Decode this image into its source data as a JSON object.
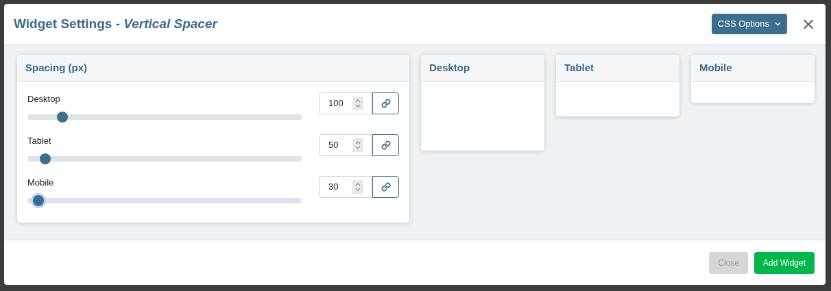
{
  "dialog": {
    "title": "Widget Settings - ",
    "subtitle": "Vertical Spacer",
    "css_button": "CSS Options",
    "close_icon": "×"
  },
  "spacing": {
    "title": "Spacing (px)",
    "rows": [
      {
        "label": "Desktop",
        "level": 0.11,
        "focused": false,
        "value": "100"
      },
      {
        "label": "Tablet",
        "level": 0.045,
        "focused": false,
        "value": "50"
      },
      {
        "label": "Mobile",
        "level": 0.02,
        "focused": true,
        "value": "30"
      }
    ]
  },
  "previews": [
    {
      "title": "Desktop",
      "kind": "desktop"
    },
    {
      "title": "Tablet",
      "kind": "tablet"
    },
    {
      "title": "Mobile",
      "kind": "mobile"
    }
  ],
  "footer": {
    "buttons": [
      {
        "label": "Close",
        "disabled": true,
        "kind": "secondary"
      },
      {
        "label": "Add Widget",
        "disabled": false,
        "kind": "primary"
      }
    ]
  }
}
